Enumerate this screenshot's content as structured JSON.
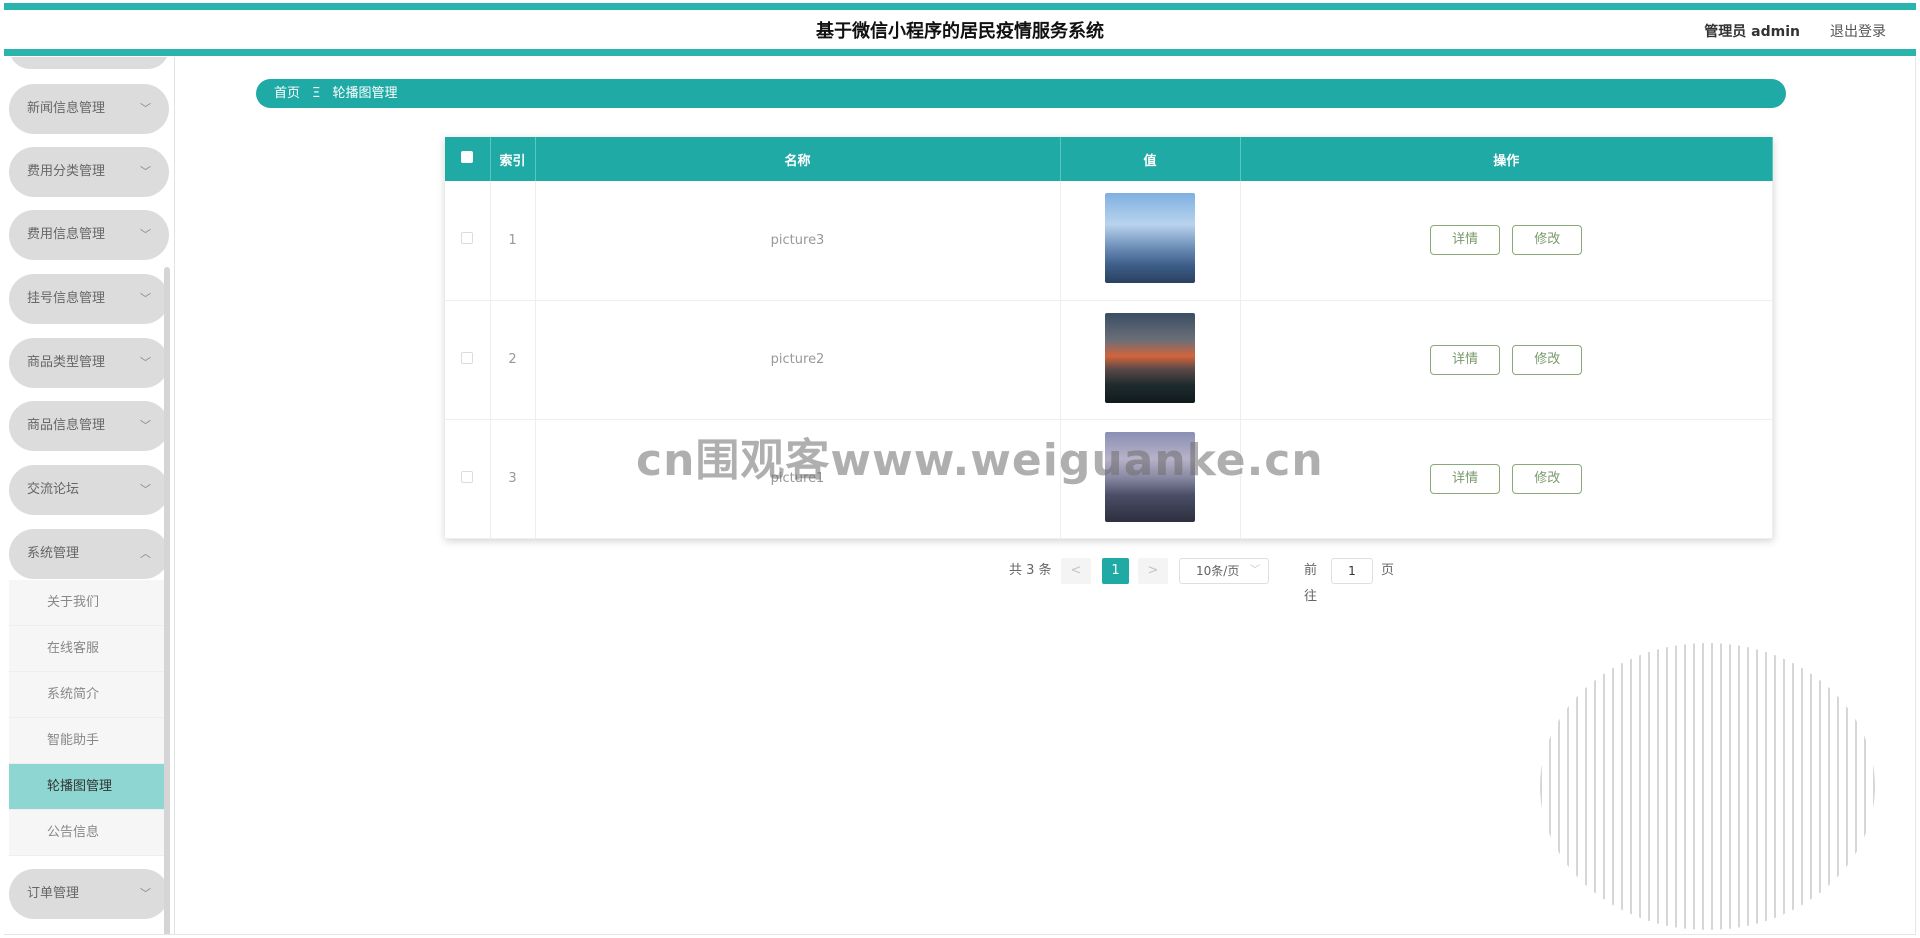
{
  "header": {
    "title": "基于微信小程序的居民疫情服务系统",
    "user": "管理员 admin",
    "logout": "退出登录"
  },
  "sidebar": {
    "menus": [
      {
        "label": "新闻信息管理",
        "expanded": false
      },
      {
        "label": "费用分类管理",
        "expanded": false
      },
      {
        "label": "费用信息管理",
        "expanded": false
      },
      {
        "label": "挂号信息管理",
        "expanded": false
      },
      {
        "label": "商品类型管理",
        "expanded": false
      },
      {
        "label": "商品信息管理",
        "expanded": false
      },
      {
        "label": "交流论坛",
        "expanded": false
      },
      {
        "label": "系统管理",
        "expanded": true
      },
      {
        "label": "订单管理",
        "expanded": false
      }
    ],
    "submenu": [
      "关于我们",
      "在线客服",
      "系统简介",
      "智能助手",
      "轮播图管理",
      "公告信息"
    ],
    "active_submenu": "轮播图管理"
  },
  "breadcrumb": {
    "home": "首页",
    "separator": "Ξ",
    "current": "轮播图管理"
  },
  "table": {
    "columns": [
      "索引",
      "名称",
      "值",
      "操作"
    ],
    "rows": [
      {
        "index": "1",
        "name": "picture3",
        "image": "city-skyline-day"
      },
      {
        "index": "2",
        "name": "picture2",
        "image": "city-skyline-sunset"
      },
      {
        "index": "3",
        "name": "picture1",
        "image": "city-skyline-dusk"
      }
    ],
    "actions": {
      "detail": "详情",
      "edit": "修改"
    }
  },
  "pagination": {
    "total": "共 3 条",
    "prev": "<",
    "current": "1",
    "next": ">",
    "page_size": "10条/页",
    "goto": "前往",
    "goto_value": "1",
    "page_suffix": "页"
  },
  "watermark": "cn围观客www.weiguanke.cn",
  "colors": {
    "accent": "#1faaa6",
    "header_stripe": "#2bb3ad",
    "active_submenu": "#8ed6d2",
    "menu_pill": "#dcdcdc",
    "button_border": "#8aa87a"
  }
}
